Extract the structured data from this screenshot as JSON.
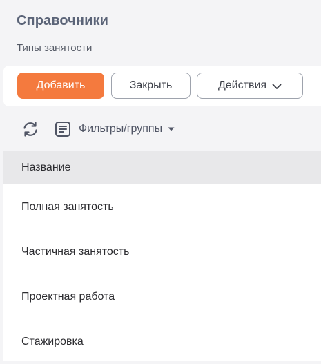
{
  "page": {
    "title": "Справочники",
    "subtitle": "Типы занятости"
  },
  "toolbar": {
    "add_label": "Добавить",
    "close_label": "Закрыть",
    "actions_label": "Действия"
  },
  "filters": {
    "label": "Фильтры/группы"
  },
  "table": {
    "header": "Название",
    "rows": [
      "Полная занятость",
      "Частичная занятость",
      "Проектная работа",
      "Стажировка"
    ]
  },
  "icons": {
    "refresh": "refresh-icon",
    "filters": "list-document-icon",
    "filters_caret": "caret-down-icon",
    "actions_chevron": "chevron-down-icon"
  },
  "colors": {
    "accent": "#f47a3e",
    "title": "#5b6478",
    "background": "#f4f4f6",
    "header_row": "#e8e8ea"
  }
}
